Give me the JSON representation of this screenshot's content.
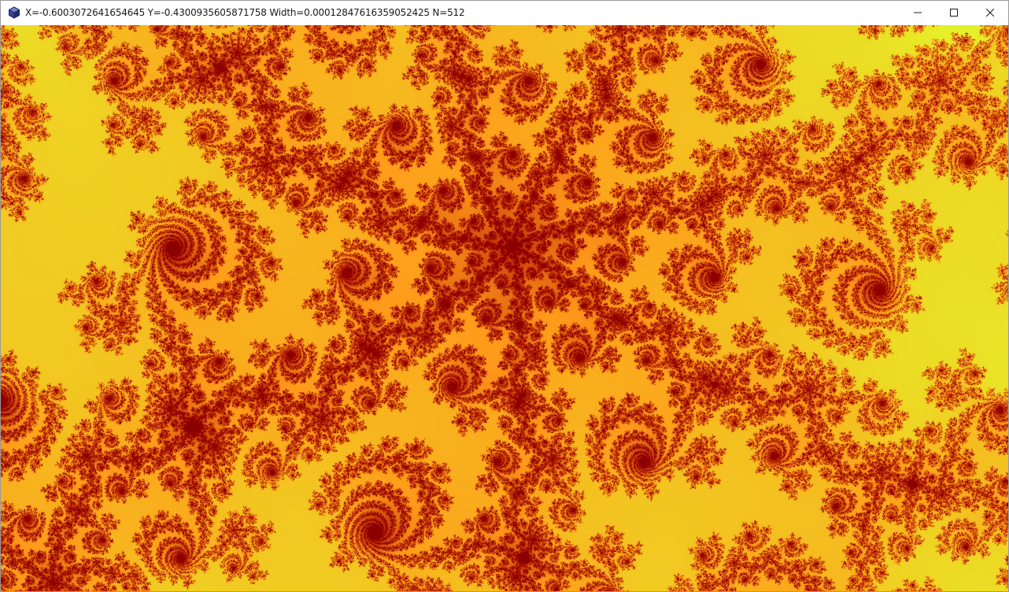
{
  "window": {
    "title": "X=-0.6003072641654645 Y=-0.4300935605871758 Width=0.00012847616359052425 N=512",
    "app_icon": "cube-icon",
    "controls": {
      "minimize_icon": "minimize-icon",
      "maximize_icon": "maximize-icon",
      "close_icon": "close-icon"
    }
  },
  "fractal": {
    "center_x": -0.6003072641654645,
    "center_y": -0.4300935605871758,
    "width": 0.00012847616359052425,
    "max_iterations": 512,
    "colors": {
      "set_color": "#8b0000",
      "low_escape": "#13d2c8",
      "mid_escape": "#8ef53a",
      "high_escape": "#ff9a1a"
    }
  }
}
